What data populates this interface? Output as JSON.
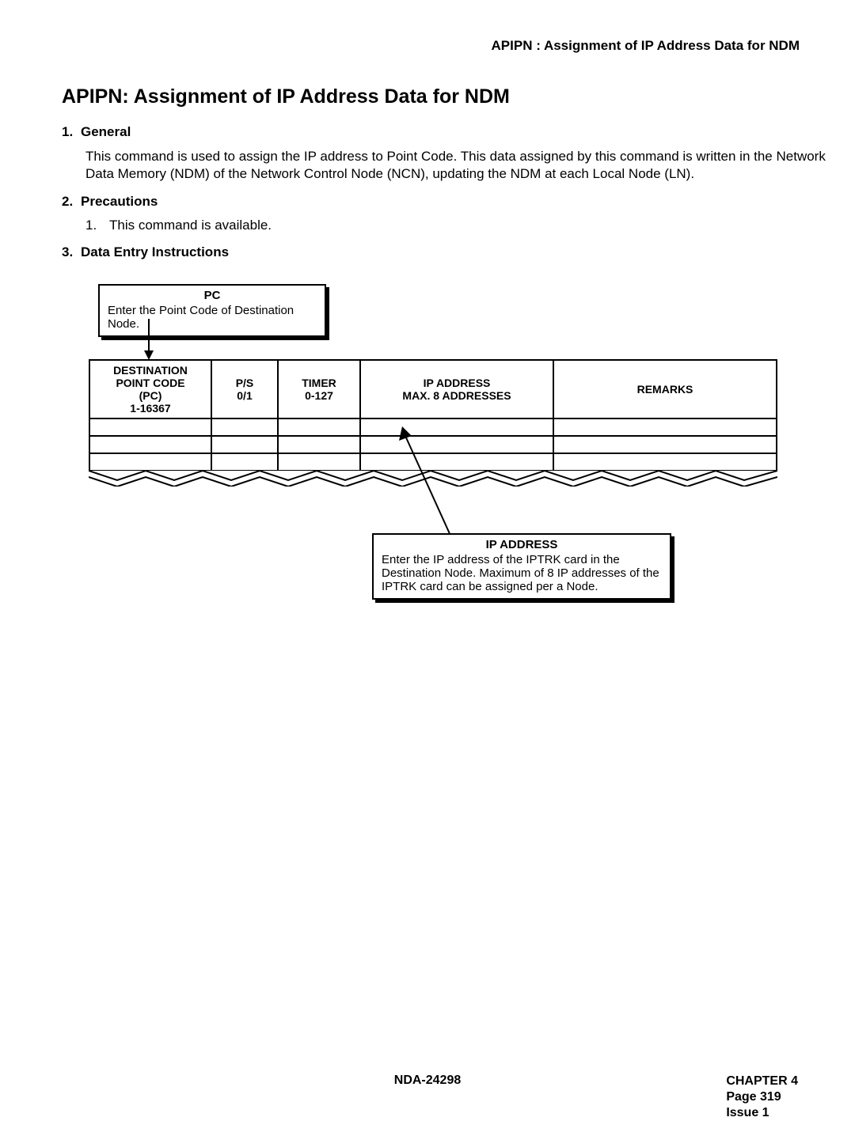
{
  "header": {
    "running_title": "APIPN : Assignment of IP Address Data for NDM"
  },
  "title": "APIPN: Assignment of IP Address Data for NDM",
  "sections": {
    "s1": {
      "num": "1.",
      "heading": "General",
      "body": "This command is used to assign the IP address to Point Code. This data assigned by this command is written in the Network Data Memory (NDM) of the Network Control Node (NCN), updating the NDM at each Local Node (LN)."
    },
    "s2": {
      "num": "2.",
      "heading": "Precautions",
      "items": [
        {
          "num": "1.",
          "text": "This command is available."
        }
      ]
    },
    "s3": {
      "num": "3.",
      "heading": "Data Entry Instructions"
    }
  },
  "callouts": {
    "pc": {
      "title": "PC",
      "text": "Enter the Point Code of Destination Node."
    },
    "ip": {
      "title": "IP ADDRESS",
      "text": "Enter the IP address of the IPTRK card in the Destination Node. Maximum of 8 IP addresses of the IPTRK card can be assigned per a Node."
    }
  },
  "table": {
    "col1": {
      "l1": "DESTINATION",
      "l2": "POINT CODE",
      "l3": "(PC)",
      "l4": "1-16367"
    },
    "col2": {
      "l1": "P/S",
      "l2": "0/1"
    },
    "col3": {
      "l1": "TIMER",
      "l2": "0-127"
    },
    "col4": {
      "l1": "IP ADDRESS",
      "l2": "MAX. 8 ADDRESSES"
    },
    "col5": {
      "l1": "REMARKS"
    }
  },
  "footer": {
    "doc_id": "NDA-24298",
    "chapter": "CHAPTER 4",
    "page": "Page 319",
    "issue": "Issue 1"
  }
}
